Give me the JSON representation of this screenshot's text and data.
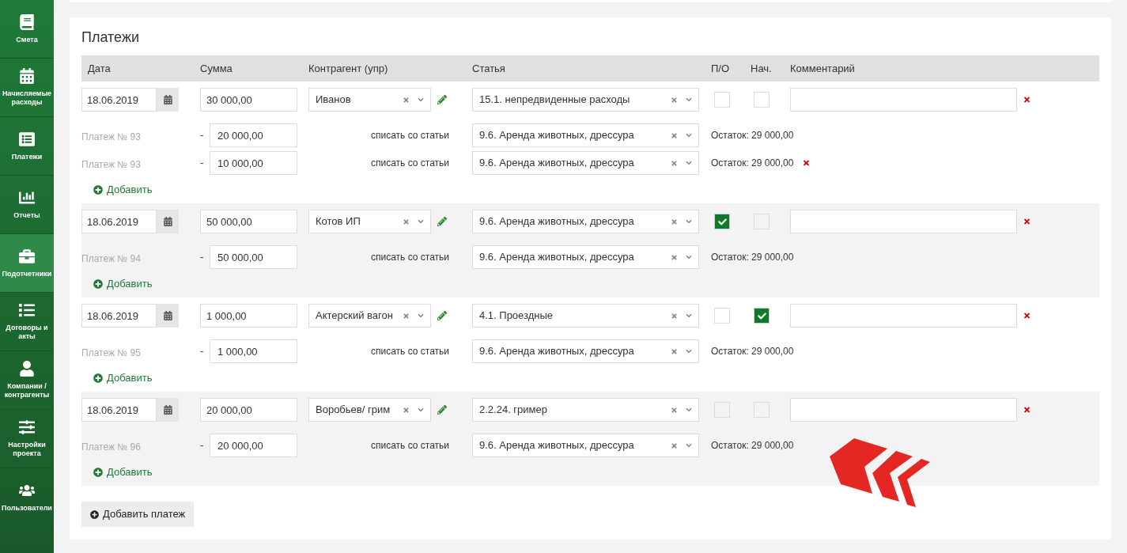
{
  "sidebar": {
    "items": [
      {
        "label": "Смета",
        "selected": false
      },
      {
        "label": "Начисляемые расходы",
        "selected": false
      },
      {
        "label": "Платежи",
        "selected": false
      },
      {
        "label": "Отчеты",
        "selected": false
      },
      {
        "label": "Подотчетники",
        "selected": true
      },
      {
        "label": "Договоры и акты",
        "selected": false
      },
      {
        "label": "Компании / контрагенты",
        "selected": false
      },
      {
        "label": "Настройки проекта",
        "selected": false
      },
      {
        "label": "Пользователи",
        "selected": false
      }
    ]
  },
  "section": {
    "title": "Платежи"
  },
  "table": {
    "columns": [
      "Дата",
      "Сумма",
      "Контрагент (упр)",
      "Статья",
      "П/О",
      "Нач.",
      "Комментарий"
    ]
  },
  "payments": [
    {
      "date": "18.06.2019",
      "amount": "30 000,00",
      "counterparty": "Иванов",
      "article": "15.1. непредвиденные расходы",
      "po_checked": false,
      "nach_checked": false,
      "add_label": "Добавить",
      "splits": [
        {
          "label": "Платеж № 93",
          "sign": "-",
          "amount": "20 000,00",
          "action": "списать со статьи",
          "article": "9.6. Аренда животных, дрессура",
          "balance": "Остаток: 29 000,00",
          "removable": false
        },
        {
          "label": "Платеж № 93",
          "sign": "-",
          "amount": "10 000,00",
          "action": "списать со статьи",
          "article": "9.6. Аренда животных, дрессура",
          "balance": "Остаток: 29 000,00",
          "removable": true
        }
      ]
    },
    {
      "date": "18.06.2019",
      "amount": "50 000,00",
      "counterparty": "Котов ИП",
      "article": "9.6. Аренда животных, дрессура",
      "po_checked": true,
      "nach_checked": false,
      "add_label": "Добавить",
      "splits": [
        {
          "label": "Платеж № 94",
          "sign": "-",
          "amount": "50 000,00",
          "action": "списать со статьи",
          "article": "9.6. Аренда животных, дрессура",
          "balance": "Остаток: 29 000,00",
          "removable": false
        }
      ]
    },
    {
      "date": "18.06.2019",
      "amount": "1 000,00",
      "counterparty": "Актерский вагон",
      "article": "4.1. Проездные",
      "po_checked": false,
      "nach_checked": true,
      "add_label": "Добавить",
      "splits": [
        {
          "label": "Платеж № 95",
          "sign": "-",
          "amount": "1 000,00",
          "action": "списать со статьи",
          "article": "9.6. Аренда животных, дрессура",
          "balance": "Остаток: 29 000,00",
          "removable": false
        }
      ]
    },
    {
      "date": "18.06.2019",
      "amount": "20 000,00",
      "counterparty": "Воробьев/ грим",
      "article": "2.2.24. гример",
      "po_checked": false,
      "nach_checked": false,
      "add_label": "Добавить",
      "splits": [
        {
          "label": "Платеж № 96",
          "sign": "-",
          "amount": "20 000,00",
          "action": "списать со статьи",
          "article": "9.6. Аренда животных, дрессура",
          "balance": "Остаток: 29 000,00",
          "removable": false
        }
      ]
    }
  ],
  "add_payment_button": "Добавить платеж"
}
